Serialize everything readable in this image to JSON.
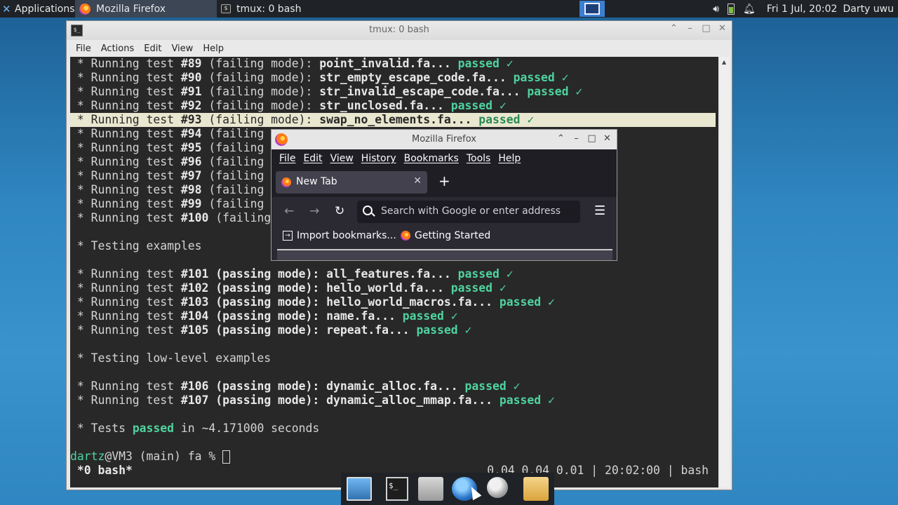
{
  "panel": {
    "apps_label": "Applications",
    "tasks": [
      {
        "label": "Mozilla Firefox"
      },
      {
        "label": "tmux: 0 bash"
      }
    ],
    "clock": "Fri  1 Jul, 20:02",
    "user": "Darty uwu"
  },
  "terminal": {
    "window_title": "tmux: 0 bash",
    "menu": [
      "File",
      "Actions",
      "Edit",
      "View",
      "Help"
    ],
    "lines_top": [
      {
        "pre": " * Running test ",
        "num": "#89",
        "mode": " (failing mode): ",
        "file": "point_invalid.fa...",
        "status": "passed",
        "check": " ✓"
      },
      {
        "pre": " * Running test ",
        "num": "#90",
        "mode": " (failing mode): ",
        "file": "str_empty_escape_code.fa...",
        "status": "passed",
        "check": " ✓"
      },
      {
        "pre": " * Running test ",
        "num": "#91",
        "mode": " (failing mode): ",
        "file": "str_invalid_escape_code.fa...",
        "status": "passed",
        "check": " ✓"
      },
      {
        "pre": " * Running test ",
        "num": "#92",
        "mode": " (failing mode): ",
        "file": "str_unclosed.fa...",
        "status": "passed",
        "check": " ✓"
      },
      {
        "pre": " * Running test ",
        "num": "#93",
        "mode": " (failing mode): ",
        "file": "swap_no_elements.fa...",
        "status": "passed",
        "check": " ✓"
      }
    ],
    "lines_partial": [
      {
        "pre": " * Running test ",
        "num": "#94",
        "mode": " (failing"
      },
      {
        "pre": " * Running test ",
        "num": "#95",
        "mode": " (failing"
      },
      {
        "pre": " * Running test ",
        "num": "#96",
        "mode": " (failing"
      },
      {
        "pre": " * Running test ",
        "num": "#97",
        "mode": " (failing"
      },
      {
        "pre": " * Running test ",
        "num": "#98",
        "mode": " (failing"
      },
      {
        "pre": " * Running test ",
        "num": "#99",
        "mode": " (failing"
      },
      {
        "pre": " * Running test ",
        "num": "#100",
        "mode": " (failing"
      }
    ],
    "section_examples": " * Testing examples",
    "lines_examples": [
      {
        "pre": " * Running test ",
        "num": "#101",
        "mode": " (passing mode): ",
        "file": "all_features.fa...",
        "status": "passed",
        "check": " ✓"
      },
      {
        "pre": " * Running test ",
        "num": "#102",
        "mode": " (passing mode): ",
        "file": "hello_world.fa...",
        "status": "passed",
        "check": " ✓"
      },
      {
        "pre": " * Running test ",
        "num": "#103",
        "mode": " (passing mode): ",
        "file": "hello_world_macros.fa...",
        "status": "passed",
        "check": " ✓"
      },
      {
        "pre": " * Running test ",
        "num": "#104",
        "mode": " (passing mode): ",
        "file": "name.fa...",
        "status": "passed",
        "check": " ✓"
      },
      {
        "pre": " * Running test ",
        "num": "#105",
        "mode": " (passing mode): ",
        "file": "repeat.fa...",
        "status": "passed",
        "check": " ✓"
      }
    ],
    "section_lowlevel": " * Testing low-level examples",
    "lines_lowlevel": [
      {
        "pre": " * Running test ",
        "num": "#106",
        "mode": " (passing mode): ",
        "file": "dynamic_alloc.fa...",
        "status": "passed",
        "check": " ✓"
      },
      {
        "pre": " * Running test ",
        "num": "#107",
        "mode": " (passing mode): ",
        "file": "dynamic_alloc_mmap.fa...",
        "status": "passed",
        "check": " ✓"
      }
    ],
    "summary": {
      "pre": " * Tests ",
      "word": "passed",
      "post": " in ~4.171000 seconds"
    },
    "prompt": {
      "user": "dartz",
      "rest": "@VM3 (main) fa % "
    },
    "status_left": " *0 bash*",
    "status_right": "0.04 0.04 0.01 | 20:02:00 | bash"
  },
  "firefox": {
    "window_title": "Mozilla Firefox",
    "menu": [
      "File",
      "Edit",
      "View",
      "History",
      "Bookmarks",
      "Tools",
      "Help"
    ],
    "tab_label": "New Tab",
    "url_placeholder": "Search with Google or enter address",
    "bookmarks": [
      "Import bookmarks...",
      "Getting Started"
    ]
  }
}
